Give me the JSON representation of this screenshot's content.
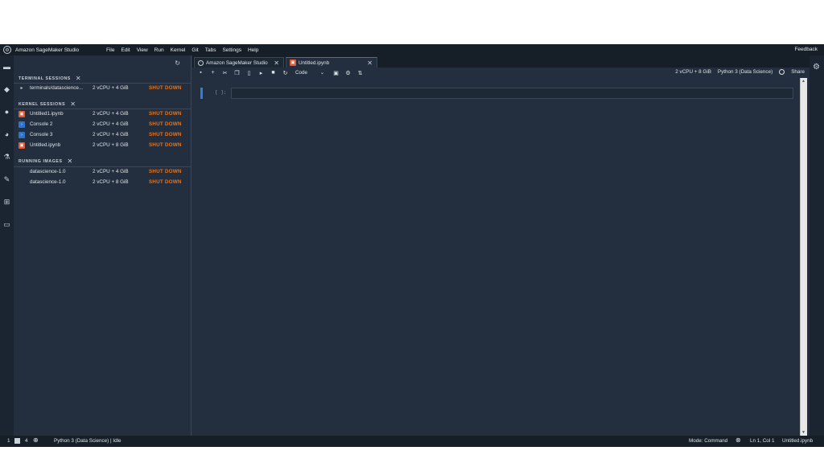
{
  "app": {
    "title": "Amazon SageMaker Studio"
  },
  "menubar": {
    "menus": [
      "File",
      "Edit",
      "View",
      "Run",
      "Kernel",
      "Git",
      "Tabs",
      "Settings",
      "Help"
    ],
    "feedback": "Feedback"
  },
  "sidepanel": {
    "terminal_sessions": {
      "heading": "TERMINAL SESSIONS",
      "rows": [
        {
          "name": "terminals/datascience...",
          "resources": "2 vCPU + 4 GiB",
          "action": "SHUT DOWN"
        }
      ]
    },
    "kernel_sessions": {
      "heading": "KERNEL SESSIONS",
      "rows": [
        {
          "name": "Untitled1.ipynb",
          "resources": "2 vCPU + 4 GiB",
          "action": "SHUT DOWN",
          "icon": "notebook-icon"
        },
        {
          "name": "Console 2",
          "resources": "2 vCPU + 4 GiB",
          "action": "SHUT DOWN",
          "icon": "console-icon"
        },
        {
          "name": "Console 3",
          "resources": "2 vCPU + 4 GiB",
          "action": "SHUT DOWN",
          "icon": "console-icon"
        },
        {
          "name": "Untitled.ipynb",
          "resources": "2 vCPU + 8 GiB",
          "action": "SHUT DOWN",
          "icon": "notebook-icon"
        }
      ]
    },
    "running_images": {
      "heading": "RUNNING IMAGES",
      "rows": [
        {
          "name": "datascience-1.0",
          "resources": "2 vCPU + 4 GiB",
          "action": "SHUT DOWN"
        },
        {
          "name": "datascience-1.0",
          "resources": "2 vCPU + 8 GiB",
          "action": "SHUT DOWN"
        }
      ]
    }
  },
  "tabs": [
    {
      "label": "Amazon SageMaker Studio",
      "active": false
    },
    {
      "label": "Untitled.ipynb",
      "active": true
    }
  ],
  "toolbar": {
    "cell_type": "Code",
    "instance": "2 vCPU + 8 GiB",
    "kernel": "Python 3 (Data Science)",
    "share": "Share"
  },
  "notebook": {
    "prompt": "[ ]:"
  },
  "statusbar": {
    "count_a": "1",
    "count_b": "4",
    "kernel_status": "Python 3 (Data Science) | Idle",
    "mode": "Mode: Command",
    "position": "Ln 1, Col 1",
    "file": "Untitled.ipynb"
  },
  "colors": {
    "accent": "#ec7211",
    "background": "#232f3e",
    "bar": "#161e27",
    "cell_active": "#2f7ed8"
  }
}
